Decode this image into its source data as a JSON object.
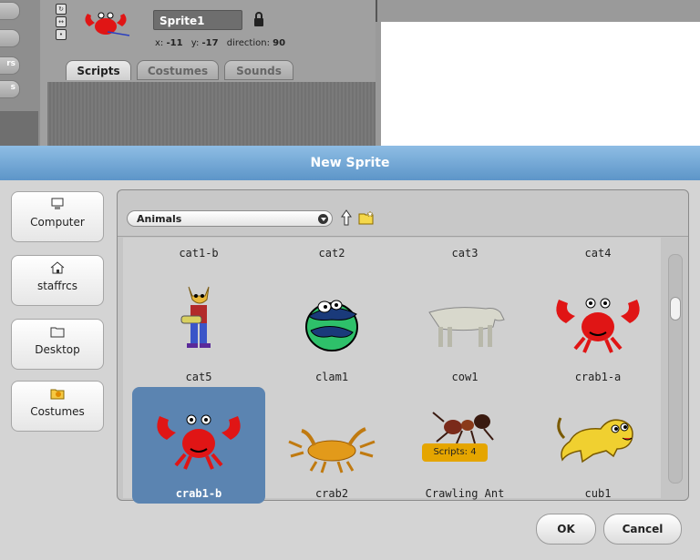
{
  "editor": {
    "side_tabs": [
      "",
      "",
      "rs",
      "s"
    ],
    "sprite": {
      "name": "Sprite1",
      "x_label": "x:",
      "x_value": "-11",
      "y_label": "y:",
      "y_value": "-17",
      "direction_label": "direction:",
      "direction_value": "90",
      "lock_icon": "lock-icon"
    },
    "tabs": [
      {
        "label": "Scripts",
        "active": true
      },
      {
        "label": "Costumes",
        "active": false
      },
      {
        "label": "Sounds",
        "active": false
      }
    ]
  },
  "dialog": {
    "title": "New Sprite",
    "places": [
      {
        "label": "Computer",
        "icon": "computer-icon"
      },
      {
        "label": "staffrcs",
        "icon": "home-icon"
      },
      {
        "label": "Desktop",
        "icon": "folder-icon"
      },
      {
        "label": "Costumes",
        "icon": "costumes-icon"
      }
    ],
    "folder": {
      "selected": "Animals"
    },
    "top_row_labels": [
      "cat1-b",
      "cat2",
      "cat3",
      "cat4"
    ],
    "items": [
      {
        "name": "cat5",
        "icon": "cat-icon"
      },
      {
        "name": "clam1",
        "icon": "clam-icon"
      },
      {
        "name": "cow1",
        "icon": "cow-icon"
      },
      {
        "name": "crab1-a",
        "icon": "crab-icon"
      },
      {
        "name": "crab1-b",
        "icon": "crab-icon",
        "selected": true
      },
      {
        "name": "crab2",
        "icon": "crab-icon"
      },
      {
        "name": "Crawling Ant",
        "icon": "ant-icon",
        "badge": "Scripts: 4"
      },
      {
        "name": "cub1",
        "icon": "lion-cub-icon"
      }
    ],
    "buttons": {
      "ok": "OK",
      "cancel": "Cancel"
    }
  },
  "colors": {
    "title_bar": "#6fa4d4",
    "selected_tile": "#5b84b1",
    "crab_red": "#e01515",
    "badge": "#e5a500"
  }
}
